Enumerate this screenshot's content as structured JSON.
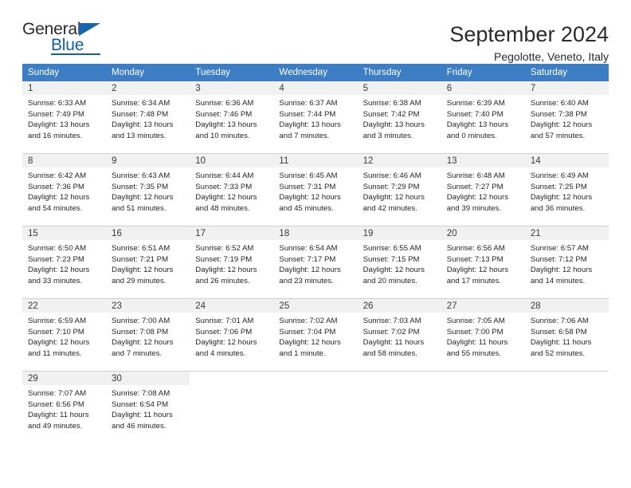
{
  "brand": {
    "name_top": "General",
    "name_bottom": "Blue",
    "accent_color": "#1060aa"
  },
  "header": {
    "title": "September 2024",
    "subtitle": "Pegolotte, Veneto, Italy",
    "header_bg_color": "#3c7dc4",
    "daynum_bg_color": "#f1f1f1"
  },
  "columns": [
    "Sunday",
    "Monday",
    "Tuesday",
    "Wednesday",
    "Thursday",
    "Friday",
    "Saturday"
  ],
  "labels": {
    "sunrise_prefix": "Sunrise:",
    "sunset_prefix": "Sunset:",
    "daylight_prefix": "Daylight:"
  },
  "weeks": [
    [
      {
        "day": "1",
        "sunrise": "Sunrise: 6:33 AM",
        "sunset": "Sunset: 7:49 PM",
        "daylight_1": "Daylight: 13 hours",
        "daylight_2": "and 16 minutes."
      },
      {
        "day": "2",
        "sunrise": "Sunrise: 6:34 AM",
        "sunset": "Sunset: 7:48 PM",
        "daylight_1": "Daylight: 13 hours",
        "daylight_2": "and 13 minutes."
      },
      {
        "day": "3",
        "sunrise": "Sunrise: 6:36 AM",
        "sunset": "Sunset: 7:46 PM",
        "daylight_1": "Daylight: 13 hours",
        "daylight_2": "and 10 minutes."
      },
      {
        "day": "4",
        "sunrise": "Sunrise: 6:37 AM",
        "sunset": "Sunset: 7:44 PM",
        "daylight_1": "Daylight: 13 hours",
        "daylight_2": "and 7 minutes."
      },
      {
        "day": "5",
        "sunrise": "Sunrise: 6:38 AM",
        "sunset": "Sunset: 7:42 PM",
        "daylight_1": "Daylight: 13 hours",
        "daylight_2": "and 3 minutes."
      },
      {
        "day": "6",
        "sunrise": "Sunrise: 6:39 AM",
        "sunset": "Sunset: 7:40 PM",
        "daylight_1": "Daylight: 13 hours",
        "daylight_2": "and 0 minutes."
      },
      {
        "day": "7",
        "sunrise": "Sunrise: 6:40 AM",
        "sunset": "Sunset: 7:38 PM",
        "daylight_1": "Daylight: 12 hours",
        "daylight_2": "and 57 minutes."
      }
    ],
    [
      {
        "day": "8",
        "sunrise": "Sunrise: 6:42 AM",
        "sunset": "Sunset: 7:36 PM",
        "daylight_1": "Daylight: 12 hours",
        "daylight_2": "and 54 minutes."
      },
      {
        "day": "9",
        "sunrise": "Sunrise: 6:43 AM",
        "sunset": "Sunset: 7:35 PM",
        "daylight_1": "Daylight: 12 hours",
        "daylight_2": "and 51 minutes."
      },
      {
        "day": "10",
        "sunrise": "Sunrise: 6:44 AM",
        "sunset": "Sunset: 7:33 PM",
        "daylight_1": "Daylight: 12 hours",
        "daylight_2": "and 48 minutes."
      },
      {
        "day": "11",
        "sunrise": "Sunrise: 6:45 AM",
        "sunset": "Sunset: 7:31 PM",
        "daylight_1": "Daylight: 12 hours",
        "daylight_2": "and 45 minutes."
      },
      {
        "day": "12",
        "sunrise": "Sunrise: 6:46 AM",
        "sunset": "Sunset: 7:29 PM",
        "daylight_1": "Daylight: 12 hours",
        "daylight_2": "and 42 minutes."
      },
      {
        "day": "13",
        "sunrise": "Sunrise: 6:48 AM",
        "sunset": "Sunset: 7:27 PM",
        "daylight_1": "Daylight: 12 hours",
        "daylight_2": "and 39 minutes."
      },
      {
        "day": "14",
        "sunrise": "Sunrise: 6:49 AM",
        "sunset": "Sunset: 7:25 PM",
        "daylight_1": "Daylight: 12 hours",
        "daylight_2": "and 36 minutes."
      }
    ],
    [
      {
        "day": "15",
        "sunrise": "Sunrise: 6:50 AM",
        "sunset": "Sunset: 7:23 PM",
        "daylight_1": "Daylight: 12 hours",
        "daylight_2": "and 33 minutes."
      },
      {
        "day": "16",
        "sunrise": "Sunrise: 6:51 AM",
        "sunset": "Sunset: 7:21 PM",
        "daylight_1": "Daylight: 12 hours",
        "daylight_2": "and 29 minutes."
      },
      {
        "day": "17",
        "sunrise": "Sunrise: 6:52 AM",
        "sunset": "Sunset: 7:19 PM",
        "daylight_1": "Daylight: 12 hours",
        "daylight_2": "and 26 minutes."
      },
      {
        "day": "18",
        "sunrise": "Sunrise: 6:54 AM",
        "sunset": "Sunset: 7:17 PM",
        "daylight_1": "Daylight: 12 hours",
        "daylight_2": "and 23 minutes."
      },
      {
        "day": "19",
        "sunrise": "Sunrise: 6:55 AM",
        "sunset": "Sunset: 7:15 PM",
        "daylight_1": "Daylight: 12 hours",
        "daylight_2": "and 20 minutes."
      },
      {
        "day": "20",
        "sunrise": "Sunrise: 6:56 AM",
        "sunset": "Sunset: 7:13 PM",
        "daylight_1": "Daylight: 12 hours",
        "daylight_2": "and 17 minutes."
      },
      {
        "day": "21",
        "sunrise": "Sunrise: 6:57 AM",
        "sunset": "Sunset: 7:12 PM",
        "daylight_1": "Daylight: 12 hours",
        "daylight_2": "and 14 minutes."
      }
    ],
    [
      {
        "day": "22",
        "sunrise": "Sunrise: 6:59 AM",
        "sunset": "Sunset: 7:10 PM",
        "daylight_1": "Daylight: 12 hours",
        "daylight_2": "and 11 minutes."
      },
      {
        "day": "23",
        "sunrise": "Sunrise: 7:00 AM",
        "sunset": "Sunset: 7:08 PM",
        "daylight_1": "Daylight: 12 hours",
        "daylight_2": "and 7 minutes."
      },
      {
        "day": "24",
        "sunrise": "Sunrise: 7:01 AM",
        "sunset": "Sunset: 7:06 PM",
        "daylight_1": "Daylight: 12 hours",
        "daylight_2": "and 4 minutes."
      },
      {
        "day": "25",
        "sunrise": "Sunrise: 7:02 AM",
        "sunset": "Sunset: 7:04 PM",
        "daylight_1": "Daylight: 12 hours",
        "daylight_2": "and 1 minute."
      },
      {
        "day": "26",
        "sunrise": "Sunrise: 7:03 AM",
        "sunset": "Sunset: 7:02 PM",
        "daylight_1": "Daylight: 11 hours",
        "daylight_2": "and 58 minutes."
      },
      {
        "day": "27",
        "sunrise": "Sunrise: 7:05 AM",
        "sunset": "Sunset: 7:00 PM",
        "daylight_1": "Daylight: 11 hours",
        "daylight_2": "and 55 minutes."
      },
      {
        "day": "28",
        "sunrise": "Sunrise: 7:06 AM",
        "sunset": "Sunset: 6:58 PM",
        "daylight_1": "Daylight: 11 hours",
        "daylight_2": "and 52 minutes."
      }
    ],
    [
      {
        "day": "29",
        "sunrise": "Sunrise: 7:07 AM",
        "sunset": "Sunset: 6:56 PM",
        "daylight_1": "Daylight: 11 hours",
        "daylight_2": "and 49 minutes."
      },
      {
        "day": "30",
        "sunrise": "Sunrise: 7:08 AM",
        "sunset": "Sunset: 6:54 PM",
        "daylight_1": "Daylight: 11 hours",
        "daylight_2": "and 46 minutes."
      },
      {
        "day": "",
        "sunrise": "",
        "sunset": "",
        "daylight_1": "",
        "daylight_2": ""
      },
      {
        "day": "",
        "sunrise": "",
        "sunset": "",
        "daylight_1": "",
        "daylight_2": ""
      },
      {
        "day": "",
        "sunrise": "",
        "sunset": "",
        "daylight_1": "",
        "daylight_2": ""
      },
      {
        "day": "",
        "sunrise": "",
        "sunset": "",
        "daylight_1": "",
        "daylight_2": ""
      },
      {
        "day": "",
        "sunrise": "",
        "sunset": "",
        "daylight_1": "",
        "daylight_2": ""
      }
    ]
  ]
}
